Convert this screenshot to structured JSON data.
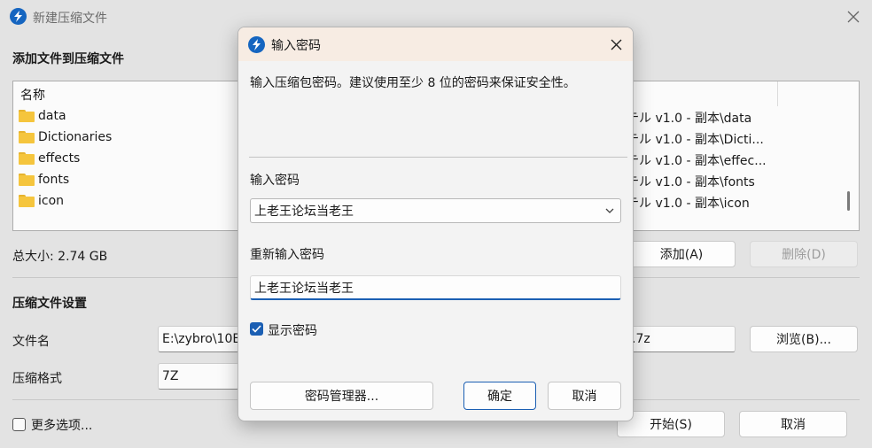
{
  "main_window": {
    "title": "新建压缩文件",
    "add_section_title": "添加文件到压缩文件",
    "file_list": {
      "column_name": "名称",
      "files": [
        {
          "name": "data",
          "path": "テル v1.0 - 副本\\data"
        },
        {
          "name": "Dictionaries",
          "path": "テル v1.0 - 副本\\Dicti..."
        },
        {
          "name": "effects",
          "path": "テル v1.0 - 副本\\effec..."
        },
        {
          "name": "fonts",
          "path": "テル v1.0 - 副本\\fonts"
        },
        {
          "name": "icon",
          "path": "テル v1.0 - 副本\\icon"
        }
      ]
    },
    "total_size": "总大小: 2.74 GB",
    "add_button": "添加(A)",
    "delete_button": "删除(D)",
    "settings_section_title": "压缩文件设置",
    "filename_label": "文件名",
    "filename_value": "E:\\zybro\\10E",
    "filename_suffix": ".7z",
    "browse_button": "浏览(B)...",
    "format_label": "压缩格式",
    "format_value": "7Z",
    "more_options_label": "更多选项...",
    "start_button": "开始(S)",
    "cancel_button": "取消"
  },
  "dialog": {
    "title": "输入密码",
    "description": "输入压缩包密码。建议使用至少 8 位的密码来保证安全性。",
    "password_label": "输入密码",
    "password_value": "上老王论坛当老王",
    "confirm_label": "重新输入密码",
    "confirm_value": "上老王论坛当老王",
    "show_password_label": "显示密码",
    "show_password_checked": true,
    "manager_button": "密码管理器...",
    "ok_button": "确定",
    "cancel_button": "取消"
  },
  "colors": {
    "accent": "#1b5fb3",
    "dialog_titlebar": "#f7ece3",
    "folder": "#f5c53d"
  }
}
